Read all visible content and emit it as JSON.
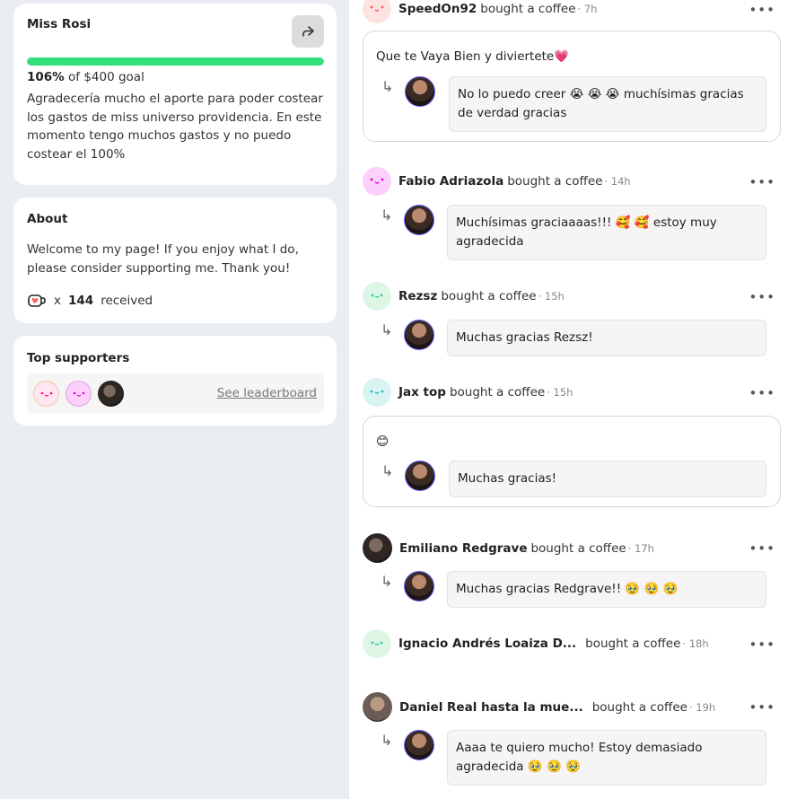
{
  "profile": {
    "name": "Miss Rosi",
    "goal_pct": "106%",
    "goal_text": "of $400 goal",
    "progress_fraction": 1.0,
    "description": "Agradecería mucho el aporte para poder costear los gastos de miss universo providencia. En este momento tengo muchos gastos y no puedo costear el 100%"
  },
  "about": {
    "title": "About",
    "text": "Welcome to my page! If you enjoy what I do, please consider supporting me. Thank you!",
    "times": "x",
    "count": "144",
    "received": "received"
  },
  "supporters": {
    "title": "Top supporters",
    "see_leaderboard": "See leaderboard"
  },
  "feed": [
    {
      "name": "SpeedOn92",
      "action": "bought a coffee",
      "time": "· 7h",
      "message": "Que te Vaya Bien y diviertete💗",
      "reply": "No lo puedo creer 😭 😭 😭 muchísimas gracias de verdad gracias"
    },
    {
      "name": "Fabio Adriazola",
      "action": "bought a coffee",
      "time": "· 14h",
      "reply": "Muchísimas graciaaaas!!! 🥰 🥰 estoy muy agradecida"
    },
    {
      "name": "Rezsz",
      "action": "bought a coffee",
      "time": "· 15h",
      "reply": "Muchas gracias Rezsz!"
    },
    {
      "name": "Jax top",
      "action": "bought a coffee",
      "time": "· 15h",
      "message": "😊",
      "reply": "Muchas gracias!"
    },
    {
      "name": "Emiliano Redgrave",
      "action": "bought a coffee",
      "time": "· 17h",
      "reply": "Muchas gracias Redgrave!! 🥹 🥹 🥹"
    },
    {
      "name": "Ignacio Andrés Loaiza D...",
      "action": "bought a coffee",
      "time": "· 18h"
    },
    {
      "name": "Daniel Real hasta la mue...",
      "action": "bought a coffee",
      "time": "· 19h",
      "reply": "Aaaa te quiero mucho! Estoy demasiado agradecida 🥹 🥹 🥹"
    }
  ],
  "ui": {
    "more": "•••",
    "reply_arrow": "↳"
  },
  "icons": {
    "share": "share-icon",
    "coffee": "coffee-cup-icon"
  },
  "colors": {
    "progress": "#34e07e",
    "left_bg": "#eaedf2"
  }
}
